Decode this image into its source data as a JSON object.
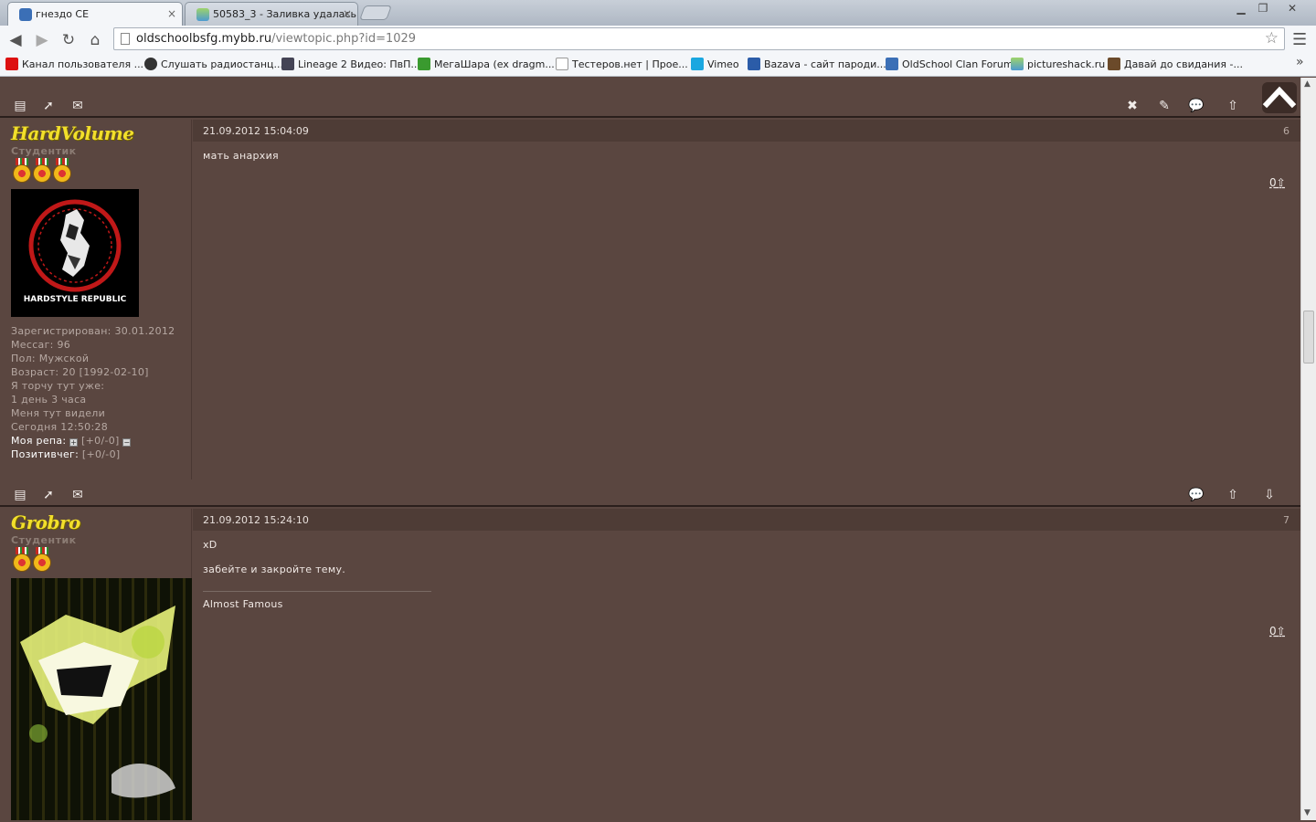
{
  "browser": {
    "tabs": [
      {
        "title": "гнездо CE",
        "active": true
      },
      {
        "title": "50583_3 - Заливка удалась",
        "active": false
      }
    ],
    "url_host": "oldschoolbsfg.mybb.ru",
    "url_path": "/viewtopic.php?id=1029",
    "bookmarks": [
      "Канал пользователя ...",
      "Слушать радиостанц...",
      "Lineage 2 Видео: ПвП...",
      "МегаШара (ex dragm...",
      "Тестеров.нет | Прое...",
      "Vimeo",
      "Bazava - сайт пароди...",
      "OldSchool Clan Forum",
      "pictureshack.ru",
      "Давай до свидания -..."
    ],
    "icons": {
      "back": "◀",
      "forward": "▶",
      "reload": "↻",
      "home": "⌂",
      "star": "☆",
      "menu": "☰",
      "more": "»",
      "close": "×"
    }
  },
  "posts": [
    {
      "author": "HardVolume",
      "rank": "Студентик",
      "avatar_text": "HARDSTYLE REPUBLIC",
      "date": "21.09.2012 15:04:09",
      "number": "6",
      "body": [
        "мать анархия"
      ],
      "signature": "",
      "rating": "0",
      "info": [
        "Зарегистрирован: 30.01.2012",
        "Мессаг: 96",
        "Пол: Мужской",
        "Возраст: 20 [1992-02-10]",
        "Я торчу тут уже:",
        "1 день 3 часа",
        "Меня тут видели",
        "Сегодня 12:50:28"
      ],
      "rep_label": "Моя репа:",
      "rep_value": "[+0/-0]",
      "pos_label": "Позитивчег:",
      "pos_value": "[+0/-0]",
      "medals": 3
    },
    {
      "author": "Grobro",
      "rank": "Студентик",
      "date": "21.09.2012 15:24:10",
      "number": "7",
      "body": [
        "xD",
        "забейте и закройте тему."
      ],
      "signature": "Almost Famous",
      "rating": "0",
      "medals": 2
    }
  ],
  "action_icons": {
    "profile": "▤",
    "pm": "➚",
    "email": "✉",
    "delete": "✖",
    "edit": "✎",
    "quote": "💬",
    "up": "⇧",
    "down": "⇩",
    "scroll_top": "⌃"
  }
}
